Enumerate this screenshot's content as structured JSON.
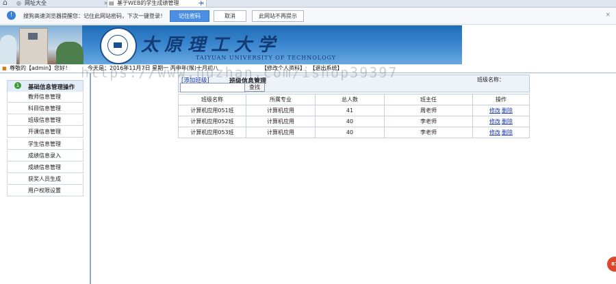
{
  "browser": {
    "tabs": [
      {
        "label": "网址大全",
        "close": "×"
      },
      {
        "label": "基于WEB的学生成绩管理",
        "close": "×"
      }
    ],
    "new_tab": "+",
    "home_icon": "home-icon"
  },
  "password_bar": {
    "message": "搜狗高速浏览器提醒您：记住此网站密码，下次一键登录！",
    "save": "记住密码",
    "cancel": "取消",
    "never": "此网站不再提示",
    "close": "×",
    "icon": "info-icon"
  },
  "banner": {
    "title_cn": "太原理工大学",
    "title_en": "TAIYUAN UNIVERSITY OF TECHNOLOGY"
  },
  "info_bar": {
    "welcome": "尊敬的【admin】您好！",
    "today": "今天是：2016年11月7日  星期一  丙申年(猴)十月初八",
    "link_password": "【修改个人资料】",
    "link_logout": "【退出系统】"
  },
  "sidebar": {
    "header": "基础信息管理操作",
    "header_num": "1",
    "items": [
      {
        "label": "教师信息管理"
      },
      {
        "label": "科目信息管理"
      },
      {
        "label": "班级信息管理"
      },
      {
        "label": "开课信息管理"
      },
      {
        "label": "学生信息管理"
      },
      {
        "label": "成绩信息录入"
      },
      {
        "label": "成绩信息管理"
      },
      {
        "label": "获奖人员生成"
      },
      {
        "label": "用户权限设置"
      }
    ]
  },
  "content": {
    "add_button": "[添加班级]",
    "title": "班级信息管理",
    "search_input": "",
    "search_button": "查找",
    "class_name_label": "班级名称：",
    "columns": [
      "班级名称",
      "所属专业",
      "总人数",
      "班主任",
      "操作"
    ],
    "rows": [
      {
        "name": "计算机应用051班",
        "major": "计算机应用",
        "count": "41",
        "teacher": "周老师",
        "edit": "修改",
        "delete": "删除"
      },
      {
        "name": "计算机应用052班",
        "major": "计算机应用",
        "count": "40",
        "teacher": "李老师",
        "edit": "修改",
        "delete": "删除"
      },
      {
        "name": "计算机应用053班",
        "major": "计算机应用",
        "count": "40",
        "teacher": "李老师",
        "edit": "修改",
        "delete": "删除"
      }
    ]
  },
  "watermark": "https://www.huzhan.com/ishop39397",
  "float_badge": "87"
}
